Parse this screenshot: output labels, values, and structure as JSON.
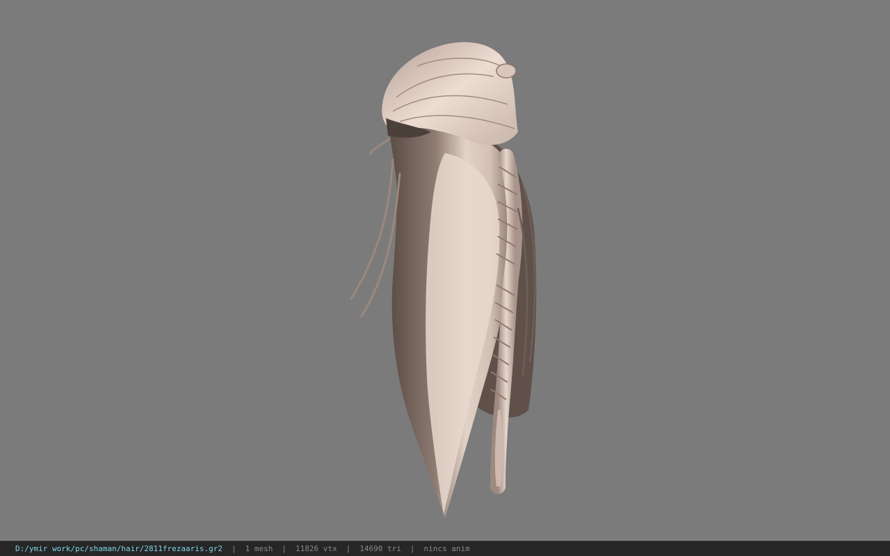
{
  "viewport": {
    "background_color": "#7b7b7b",
    "model": "hair-mesh",
    "hair_colors": {
      "light": "#e3d2c7",
      "mid": "#b59f94",
      "dark": "#5d4e47"
    }
  },
  "statusbar": {
    "file_path": "D:/ymir work/pc/shaman/hair/2811frezaaris.gr2",
    "mesh_count": "1 mesh",
    "vertex_count": "11826 vtx",
    "triangle_count": "14690 tri",
    "anim_status": "nincs anim",
    "separator": "|",
    "path_color": "#7fd6e6",
    "text_color": "#8a8a8a",
    "background_color": "#262626"
  }
}
